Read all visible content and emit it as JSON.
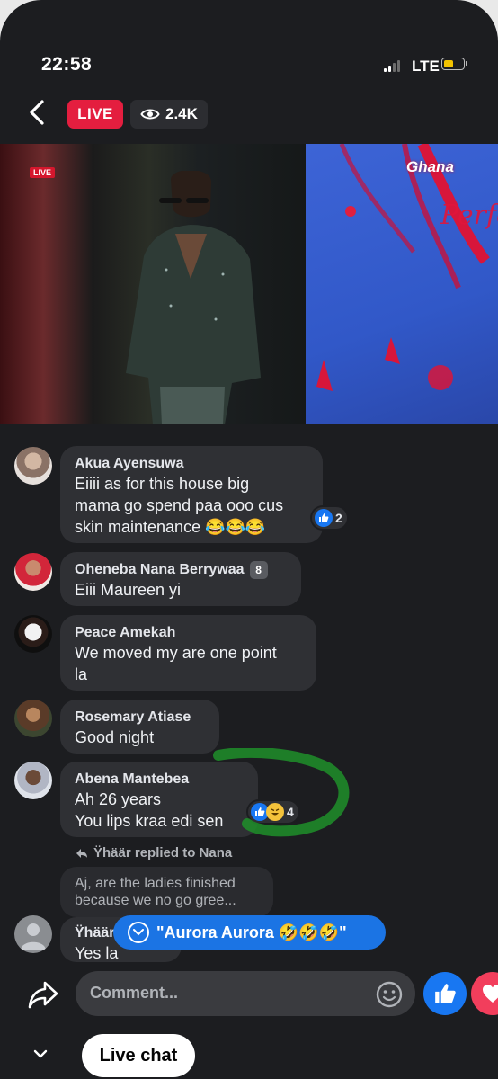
{
  "status_bar": {
    "time": "22:58",
    "network": "LTE"
  },
  "header": {
    "live_label": "LIVE",
    "viewer_count": "2.4K"
  },
  "video": {
    "live_tag": "LIVE",
    "logo_text": "Ghana",
    "overlay_text": "Perfe"
  },
  "comments": [
    {
      "name": "Akua Ayensuwa",
      "lines": [
        "Eiiii as for this house big",
        "mama go spend paa ooo cus",
        "skin maintenance 😂😂😂"
      ],
      "reaction_count": "2"
    },
    {
      "name": "Oheneba Nana Berrywaa",
      "lines": [
        "Eiii Maureen yi"
      ],
      "badge": "8"
    },
    {
      "name": "Peace Amekah",
      "lines": [
        "We moved my are one point",
        "la"
      ]
    },
    {
      "name": "Rosemary Atiase",
      "lines": [
        "Good night"
      ]
    },
    {
      "name": "Abena Mantebea",
      "lines": [
        "Ah 26 years",
        "You lips kraa edi sen"
      ],
      "reaction_count": "4"
    },
    {
      "name": "Ÿhäär",
      "lines": [
        "Yes la"
      ]
    }
  ],
  "reply_indicator": "Ÿhäär replied to Nana",
  "quoted_reply": {
    "lines": [
      "Aj, are the ladies finished",
      "because we no go gree..."
    ]
  },
  "new_comment_pill": "\"Aurora Aurora 🤣🤣🤣\"",
  "composer": {
    "placeholder": "Comment..."
  },
  "tabs": {
    "live_chat": "Live chat"
  },
  "colors": {
    "live_red": "#e41e3f",
    "facebook_blue": "#1877f2",
    "love_red": "#f23e5c",
    "bubble": "#2f3034",
    "background": "#1c1d20"
  }
}
